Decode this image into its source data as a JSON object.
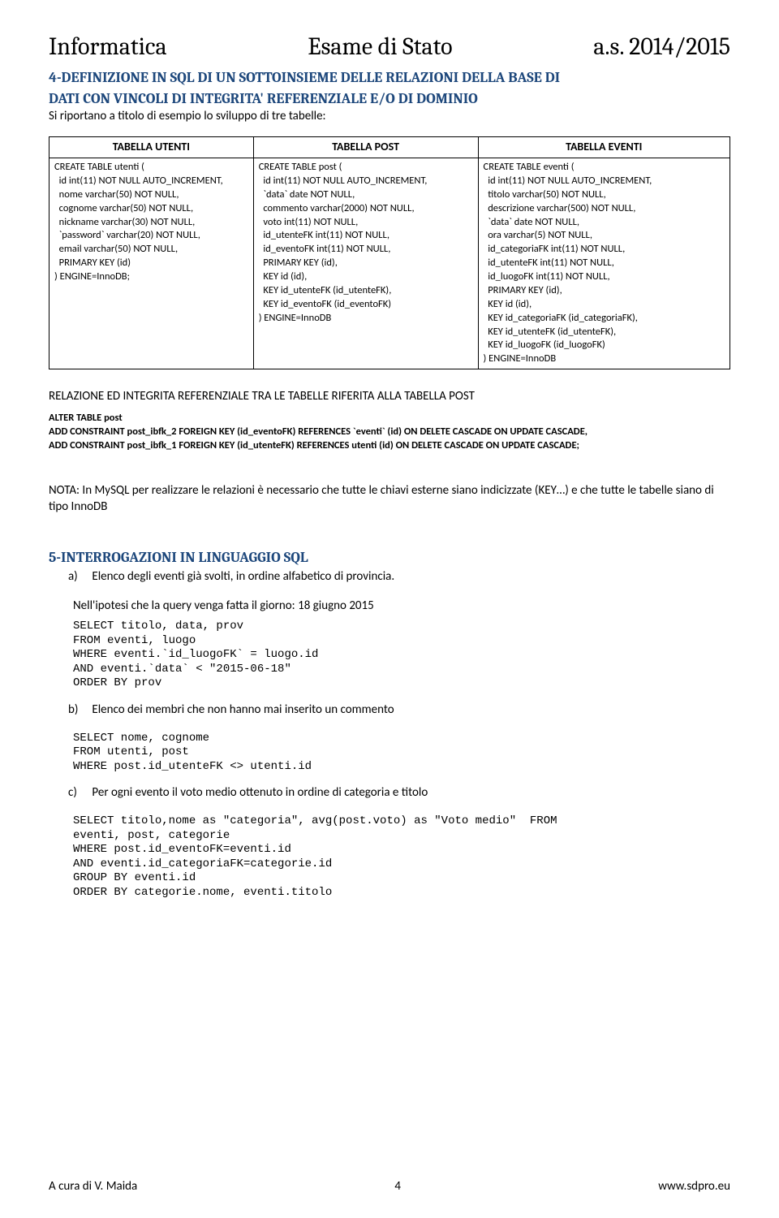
{
  "header": {
    "left": "Informatica",
    "center": "Esame di Stato",
    "right": "a.s. 2014/2015"
  },
  "section4": {
    "title_l1": "4-DEFINIZIONE IN SQL DI UN SOTTOINSIEME DELLE RELAZIONI DELLA BASE DI",
    "title_l2": "DATI CON VINCOLI DI INTEGRITA' REFERENZIALE E/O DI DOMINIO",
    "intro": "Si riportano a titolo di esempio lo sviluppo di tre tabelle:"
  },
  "table": {
    "h1": "TABELLA UTENTI",
    "h2": "TABELLA POST",
    "h3": "TABELLA EVENTI",
    "c1": "CREATE TABLE utenti (\n  id int(11) NOT NULL AUTO_INCREMENT,\n  nome varchar(50) NOT NULL,\n  cognome varchar(50) NOT NULL,\n  nickname varchar(30) NOT NULL,\n  `password` varchar(20) NOT NULL,\n  email varchar(50) NOT NULL,\n  PRIMARY KEY (id)\n) ENGINE=InnoDB;",
    "c2": "CREATE TABLE post (\n  id int(11) NOT NULL AUTO_INCREMENT,\n  `data` date NOT NULL,\n  commento varchar(2000) NOT NULL,\n  voto int(11) NOT NULL,\n  id_utenteFK int(11) NOT NULL,\n  id_eventoFK int(11) NOT NULL,\n  PRIMARY KEY (id),\n  KEY id (id),\n  KEY id_utenteFK (id_utenteFK),\n  KEY id_eventoFK (id_eventoFK)\n) ENGINE=InnoDB",
    "c3": "CREATE TABLE eventi (\n  id int(11) NOT NULL AUTO_INCREMENT,\n  titolo varchar(50) NOT NULL,\n  descrizione varchar(500) NOT NULL,\n  `data` date NOT NULL,\n  ora varchar(5) NOT NULL,\n  id_categoriaFK int(11) NOT NULL,\n  id_utenteFK int(11) NOT NULL,\n  id_luogoFK int(11) NOT NULL,\n  PRIMARY KEY (id),\n  KEY id (id),\n  KEY id_categoriaFK (id_categoriaFK),\n  KEY id_utenteFK (id_utenteFK),\n  KEY id_luogoFK (id_luogoFK)\n) ENGINE=InnoDB"
  },
  "rel": {
    "title": "RELAZIONE ED INTEGRITA REFERENZIALE TRA LE TABELLE RIFERITA ALLA TABELLA POST",
    "alter_l1": "ALTER TABLE post",
    "alter_l2": " ADD CONSTRAINT post_ibfk_2 FOREIGN KEY (id_eventoFK) REFERENCES `eventi` (id) ON DELETE CASCADE ON UPDATE CASCADE,",
    "alter_l3": " ADD CONSTRAINT post_ibfk_1 FOREIGN KEY (id_utenteFK) REFERENCES utenti (id) ON DELETE CASCADE ON UPDATE CASCADE;"
  },
  "nota": "NOTA:  In MySQL per realizzare le relazioni è necessario che tutte le chiavi esterne siano indicizzate (KEY…) e che tutte le tabelle siano di tipo InnoDB",
  "section5": {
    "title": "5-INTERROGAZIONI IN LINGUAGGIO SQL",
    "a": {
      "label": "a)",
      "text": "Elenco degli eventi già svolti, in ordine alfabetico di provincia.",
      "sub": "Nell'ipotesi che la query venga fatta il giorno: 18 giugno 2015",
      "code": "SELECT titolo, data, prov\nFROM eventi, luogo\nWHERE eventi.`id_luogoFK` = luogo.id\nAND eventi.`data` < \"2015-06-18\"\nORDER BY prov"
    },
    "b": {
      "label": "b)",
      "text": "Elenco dei membri che non hanno mai inserito un commento",
      "code": "SELECT nome, cognome\nFROM utenti, post\nWHERE post.id_utenteFK <> utenti.id"
    },
    "c": {
      "label": "c)",
      "text": "Per ogni evento il voto medio ottenuto in ordine di categoria e titolo",
      "code": "SELECT titolo,nome as \"categoria\", avg(post.voto) as \"Voto medio\"  FROM\neventi, post, categorie\nWHERE post.id_eventoFK=eventi.id\nAND eventi.id_categoriaFK=categorie.id\nGROUP BY eventi.id\nORDER BY categorie.nome, eventi.titolo"
    }
  },
  "footer": {
    "left": "A cura di V. Maida",
    "center": "4",
    "right": "www.sdpro.eu"
  }
}
